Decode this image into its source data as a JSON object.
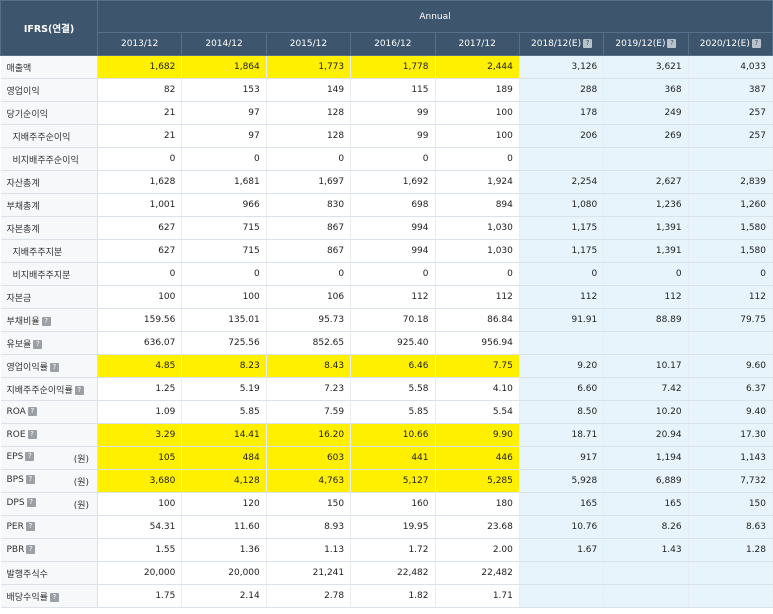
{
  "header": {
    "corner": "IFRS(연결)",
    "group": "Annual",
    "periods": [
      "2013/12",
      "2014/12",
      "2015/12",
      "2016/12",
      "2017/12",
      "2018/12(E)",
      "2019/12(E)",
      "2020/12(E)"
    ],
    "estimate_flags": [
      false,
      false,
      false,
      false,
      false,
      true,
      true,
      true
    ]
  },
  "rows": [
    {
      "label": "매출액",
      "values": [
        "1,682",
        "1,864",
        "1,773",
        "1,778",
        "2,444",
        "3,126",
        "3,621",
        "4,033"
      ],
      "highlight": true
    },
    {
      "label": "영업이익",
      "values": [
        "82",
        "153",
        "149",
        "115",
        "189",
        "288",
        "368",
        "387"
      ]
    },
    {
      "label": "당기순이익",
      "values": [
        "21",
        "97",
        "128",
        "99",
        "100",
        "178",
        "249",
        "257"
      ]
    },
    {
      "label": "지배주주순이익",
      "values": [
        "21",
        "97",
        "128",
        "99",
        "100",
        "206",
        "269",
        "257"
      ],
      "sub": true
    },
    {
      "label": "비지배주주순이익",
      "values": [
        "0",
        "0",
        "0",
        "0",
        "0",
        "",
        "",
        ""
      ],
      "sub": true
    },
    {
      "label": "자산총계",
      "values": [
        "1,628",
        "1,681",
        "1,697",
        "1,692",
        "1,924",
        "2,254",
        "2,627",
        "2,839"
      ]
    },
    {
      "label": "부채총계",
      "values": [
        "1,001",
        "966",
        "830",
        "698",
        "894",
        "1,080",
        "1,236",
        "1,260"
      ]
    },
    {
      "label": "자본총계",
      "values": [
        "627",
        "715",
        "867",
        "994",
        "1,030",
        "1,175",
        "1,391",
        "1,580"
      ]
    },
    {
      "label": "지배주주지분",
      "values": [
        "627",
        "715",
        "867",
        "994",
        "1,030",
        "1,175",
        "1,391",
        "1,580"
      ],
      "sub": true
    },
    {
      "label": "비지배주주지분",
      "values": [
        "0",
        "0",
        "0",
        "0",
        "0",
        "0",
        "0",
        "0"
      ],
      "sub": true
    },
    {
      "label": "자본금",
      "values": [
        "100",
        "100",
        "106",
        "112",
        "112",
        "112",
        "112",
        "112"
      ]
    },
    {
      "label": "부채비율",
      "values": [
        "159.56",
        "135.01",
        "95.73",
        "70.18",
        "86.84",
        "91.91",
        "88.89",
        "79.75"
      ],
      "help": true
    },
    {
      "label": "유보율",
      "values": [
        "636.07",
        "725.56",
        "852.65",
        "925.40",
        "956.94",
        "",
        "",
        ""
      ],
      "help": true
    },
    {
      "label": "영업이익률",
      "values": [
        "4.85",
        "8.23",
        "8.43",
        "6.46",
        "7.75",
        "9.20",
        "10.17",
        "9.60"
      ],
      "help": true,
      "highlight": true
    },
    {
      "label": "지배주주순이익률",
      "values": [
        "1.25",
        "5.19",
        "7.23",
        "5.58",
        "4.10",
        "6.60",
        "7.42",
        "6.37"
      ],
      "help": true
    },
    {
      "label": "ROA",
      "values": [
        "1.09",
        "5.85",
        "7.59",
        "5.85",
        "5.54",
        "8.50",
        "10.20",
        "9.40"
      ],
      "help": true
    },
    {
      "label": "ROE",
      "values": [
        "3.29",
        "14.41",
        "16.20",
        "10.66",
        "9.90",
        "18.71",
        "20.94",
        "17.30"
      ],
      "help": true,
      "highlight": true
    },
    {
      "label": "EPS",
      "values": [
        "105",
        "484",
        "603",
        "441",
        "446",
        "917",
        "1,194",
        "1,143"
      ],
      "help": true,
      "unit": "(원)",
      "highlight": true
    },
    {
      "label": "BPS",
      "values": [
        "3,680",
        "4,128",
        "4,763",
        "5,127",
        "5,285",
        "5,928",
        "6,889",
        "7,732"
      ],
      "help": true,
      "unit": "(원)",
      "highlight": true
    },
    {
      "label": "DPS",
      "values": [
        "100",
        "120",
        "150",
        "160",
        "180",
        "165",
        "165",
        "150"
      ],
      "help": true,
      "unit": "(원)"
    },
    {
      "label": "PER",
      "values": [
        "54.31",
        "11.60",
        "8.93",
        "19.95",
        "23.68",
        "10.76",
        "8.26",
        "8.63"
      ],
      "help": true
    },
    {
      "label": "PBR",
      "values": [
        "1.55",
        "1.36",
        "1.13",
        "1.72",
        "2.00",
        "1.67",
        "1.43",
        "1.28"
      ],
      "help": true
    },
    {
      "label": "발행주식수",
      "values": [
        "20,000",
        "20,000",
        "21,241",
        "22,482",
        "22,482",
        "",
        "",
        ""
      ]
    },
    {
      "label": "배당수익률",
      "values": [
        "1.75",
        "2.14",
        "2.78",
        "1.82",
        "1.71",
        "",
        "",
        ""
      ],
      "help": true
    }
  ],
  "help_glyph": "?",
  "colors": {
    "header_bg": "#3d566d",
    "estimate_bg": "#e7f4fb",
    "highlight": "#fff000"
  }
}
